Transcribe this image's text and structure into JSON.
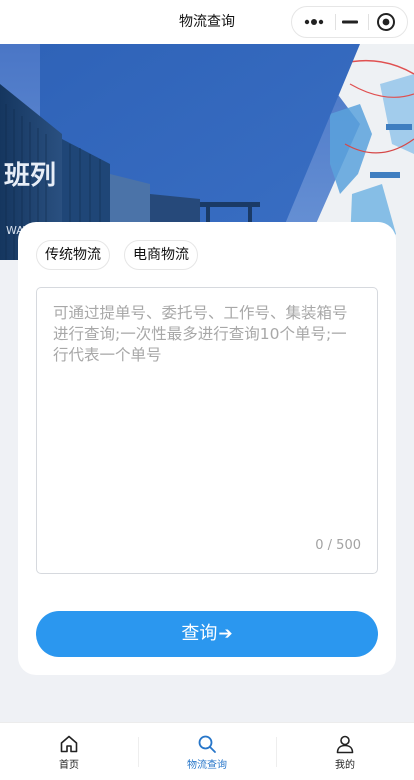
{
  "navbar": {
    "title": "物流查询",
    "capsule": {
      "more_icon": "ellipsis-icon",
      "minimize_icon": "minimize-icon",
      "close_icon": "target-close-icon"
    }
  },
  "banner": {
    "container_text": "班列",
    "container_subtext": "WAY EXP",
    "description": "railway container banner with map"
  },
  "tabs": [
    {
      "label": "传统物流"
    },
    {
      "label": "电商物流"
    }
  ],
  "search": {
    "value": "",
    "placeholder": "可通过提单号、委托号、工作号、集装箱号进行查询;一次性最多进行查询10个单号;一行代表一个单号",
    "counter": "0 / 500"
  },
  "query_button": {
    "label": "查询",
    "icon": "arrow-right-icon"
  },
  "tabbar": {
    "items": [
      {
        "label": "首页",
        "icon": "home-icon"
      },
      {
        "label": "物流查询",
        "icon": "search-icon",
        "active": true
      },
      {
        "label": "我的",
        "icon": "user-icon"
      }
    ]
  },
  "colors": {
    "accent": "#2b97ef",
    "active_tab": "#2776c9",
    "background": "#eff1f5"
  }
}
